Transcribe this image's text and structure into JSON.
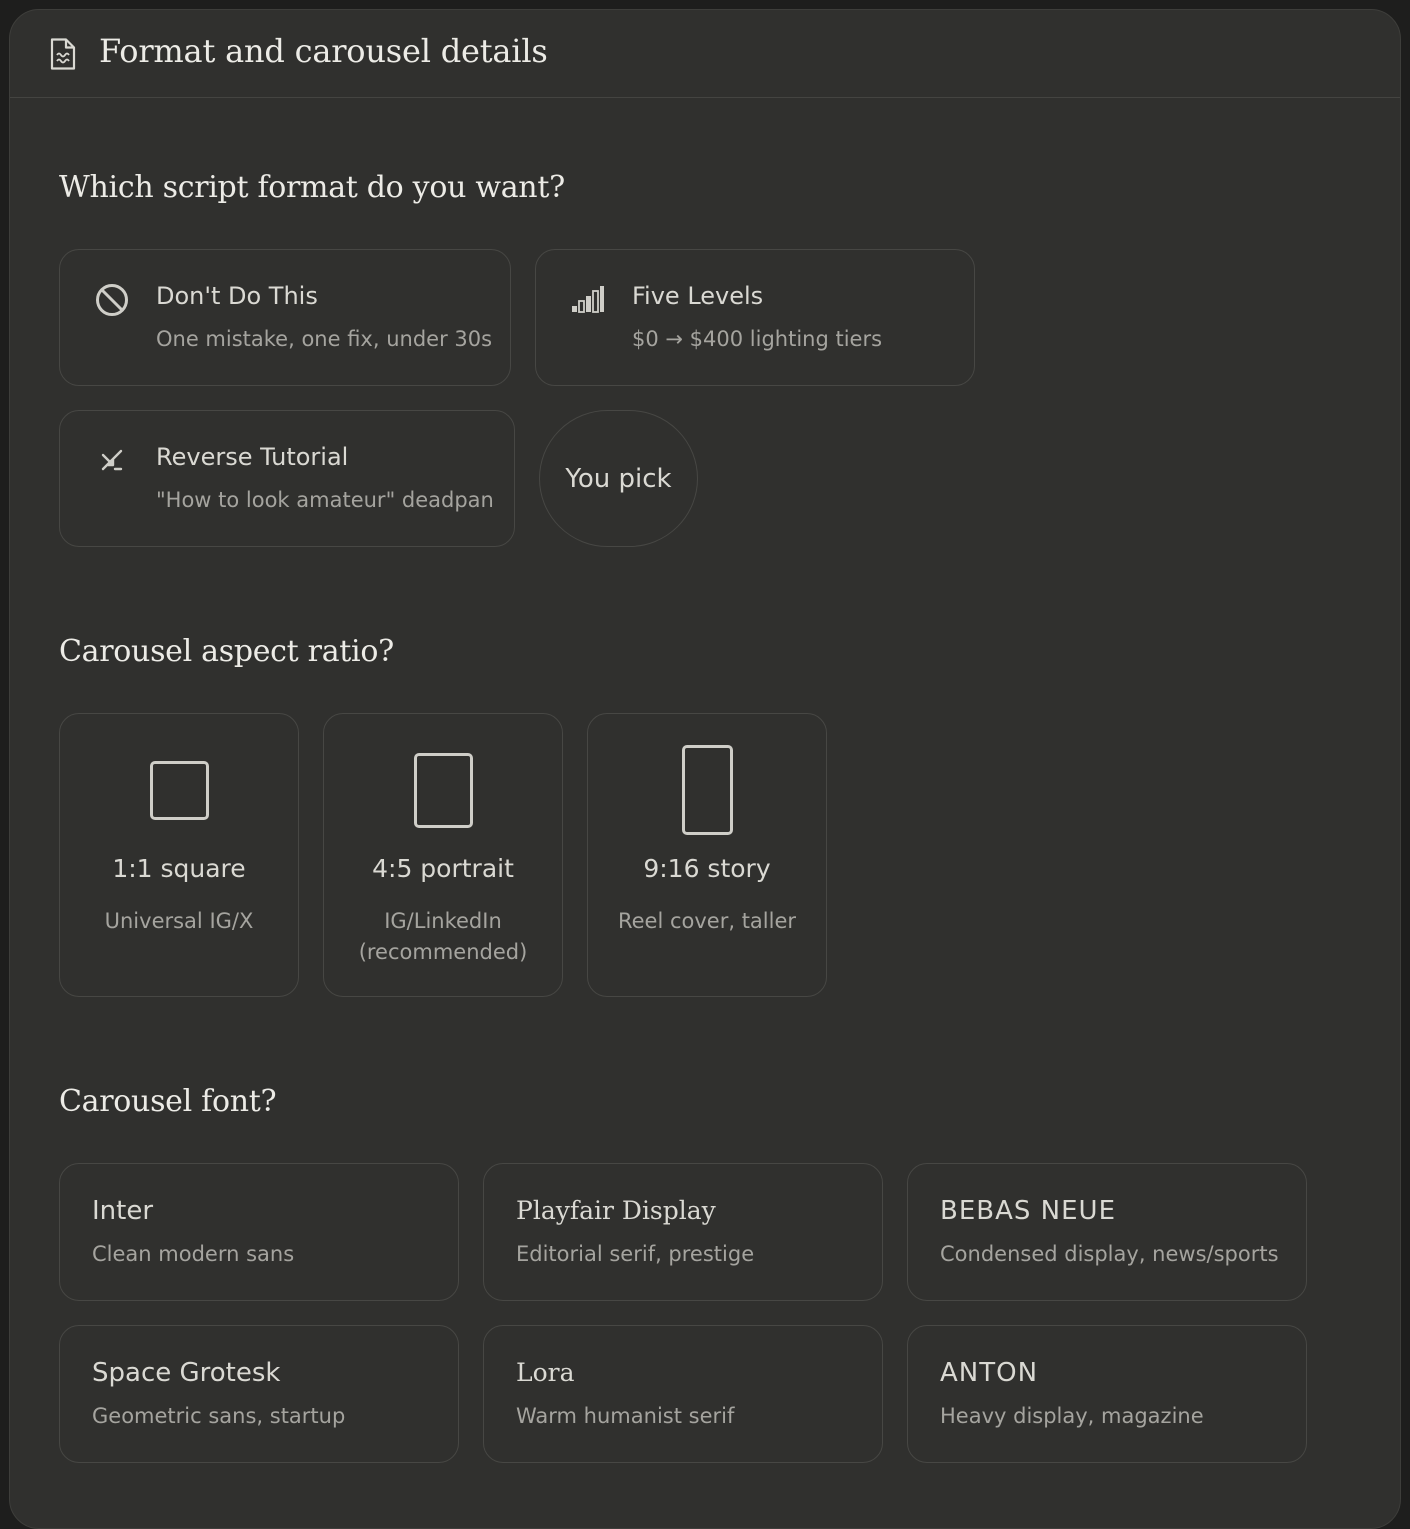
{
  "header": {
    "title": "Format and carousel details",
    "icon": "document-icon"
  },
  "script_format": {
    "question": "Which script format do you want?",
    "options": [
      {
        "label": "Don't Do This",
        "sub": "One mistake, one fix, under 30s",
        "icon": "prohibited-icon"
      },
      {
        "label": "Five Levels",
        "sub": "$0 → $400 lighting tiers",
        "icon": "signal-bars-icon"
      },
      {
        "label": "Reverse Tutorial",
        "sub": "\"How to look amateur\" deadpan",
        "icon": "reverse-arrows-icon"
      }
    ],
    "you_pick": "You pick"
  },
  "aspect_ratio": {
    "question": "Carousel aspect ratio?",
    "options": [
      {
        "label": "1:1 square",
        "sub": "Universal IG/X",
        "icon": "square-icon"
      },
      {
        "label": "4:5 portrait",
        "sub": "IG/LinkedIn (recommended)",
        "icon": "portrait-icon"
      },
      {
        "label": "9:16 story",
        "sub": "Reel cover, taller",
        "icon": "story-icon"
      }
    ]
  },
  "font": {
    "question": "Carousel font?",
    "options": [
      {
        "label": "Inter",
        "sub": "Clean modern sans"
      },
      {
        "label": "Playfair Display",
        "sub": "Editorial serif, prestige"
      },
      {
        "label": "BEBAS NEUE",
        "sub": "Condensed display, news/sports"
      },
      {
        "label": "Space Grotesk",
        "sub": "Geometric sans, startup"
      },
      {
        "label": "Lora",
        "sub": "Warm humanist serif"
      },
      {
        "label": "ANTON",
        "sub": "Heavy display, magazine"
      }
    ]
  },
  "colors": {
    "panel_bg": "#30302e",
    "page_bg": "#1e1e1d",
    "border": "#474744",
    "text_primary": "#ecebe6",
    "text_secondary": "#a5a49f"
  }
}
